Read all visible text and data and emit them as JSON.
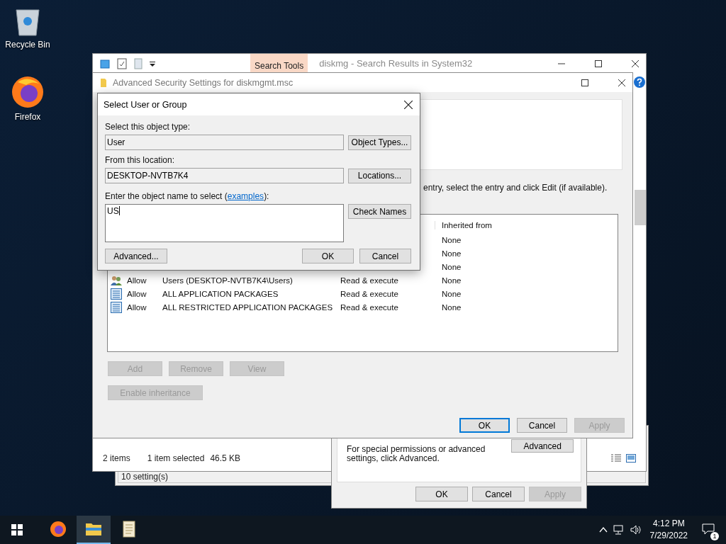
{
  "desktop_icons": [
    {
      "kind": "recycle-bin",
      "label": "Recycle Bin"
    },
    {
      "kind": "firefox",
      "label": "Firefox"
    }
  ],
  "explorer": {
    "ribbon_tab": "Search Tools",
    "title": "diskmg - Search Results in System32",
    "status_items": "2 items",
    "status_selected": "1 item selected",
    "status_size": "46.5 KB"
  },
  "background_window": {
    "status_text": "10 setting(s)"
  },
  "properties_dialog": {
    "note": "For special permissions or advanced settings, click Advanced.",
    "advanced_button": "Advanced",
    "buttons": [
      {
        "label": "OK",
        "disabled": false
      },
      {
        "label": "Cancel",
        "disabled": false
      },
      {
        "label": "Apply",
        "disabled": true
      }
    ]
  },
  "advanced_security": {
    "title": "Advanced Security Settings for diskmgmt.msc",
    "instructions": "entry, select the entry and click Edit (if available).",
    "inherited_header": "Inherited from",
    "entries": [
      {
        "inherited": "None"
      },
      {
        "inherited": "None"
      },
      {
        "inherited": "None"
      },
      {
        "kind": "group",
        "type": "Allow",
        "principal": "Users (DESKTOP-NVTB7K4\\Users)",
        "access": "Read & execute",
        "inherited": "None"
      },
      {
        "kind": "package",
        "type": "Allow",
        "principal": "ALL APPLICATION PACKAGES",
        "access": "Read & execute",
        "inherited": "None"
      },
      {
        "kind": "package",
        "type": "Allow",
        "principal": "ALL RESTRICTED APPLICATION PACKAGES",
        "access": "Read & execute",
        "inherited": "None"
      }
    ],
    "entry_buttons": [
      {
        "label": "Add",
        "disabled": true
      },
      {
        "label": "Remove",
        "disabled": true
      },
      {
        "label": "View",
        "disabled": true
      }
    ],
    "inheritance_button": {
      "label": "Enable inheritance",
      "disabled": true
    },
    "footer_buttons": [
      {
        "label": "OK",
        "disabled": false,
        "default": true
      },
      {
        "label": "Cancel",
        "disabled": false,
        "default": false
      },
      {
        "label": "Apply",
        "disabled": true,
        "default": false
      }
    ]
  },
  "select_dialog": {
    "title": "Select User or Group",
    "object_type_label": "Select this object type:",
    "object_type": "User",
    "object_types_button": "Object Types...",
    "location_label": "From this location:",
    "location": "DESKTOP-NVTB7K4",
    "locations_button": "Locations...",
    "name_label": "Enter the object name to select (",
    "name_link": "examples",
    "name_label_end": "):",
    "name_value": "US",
    "check_names_button": "Check Names",
    "advanced_button": "Advanced...",
    "ok_button": "OK",
    "cancel_button": "Cancel"
  },
  "taskbar": {
    "apps": [
      {
        "kind": "firefox",
        "active": false
      },
      {
        "kind": "explorer",
        "active": true
      },
      {
        "kind": "notepad",
        "active": false
      }
    ],
    "time": "4:12 PM",
    "date": "7/29/2022",
    "notification_count": "1"
  }
}
